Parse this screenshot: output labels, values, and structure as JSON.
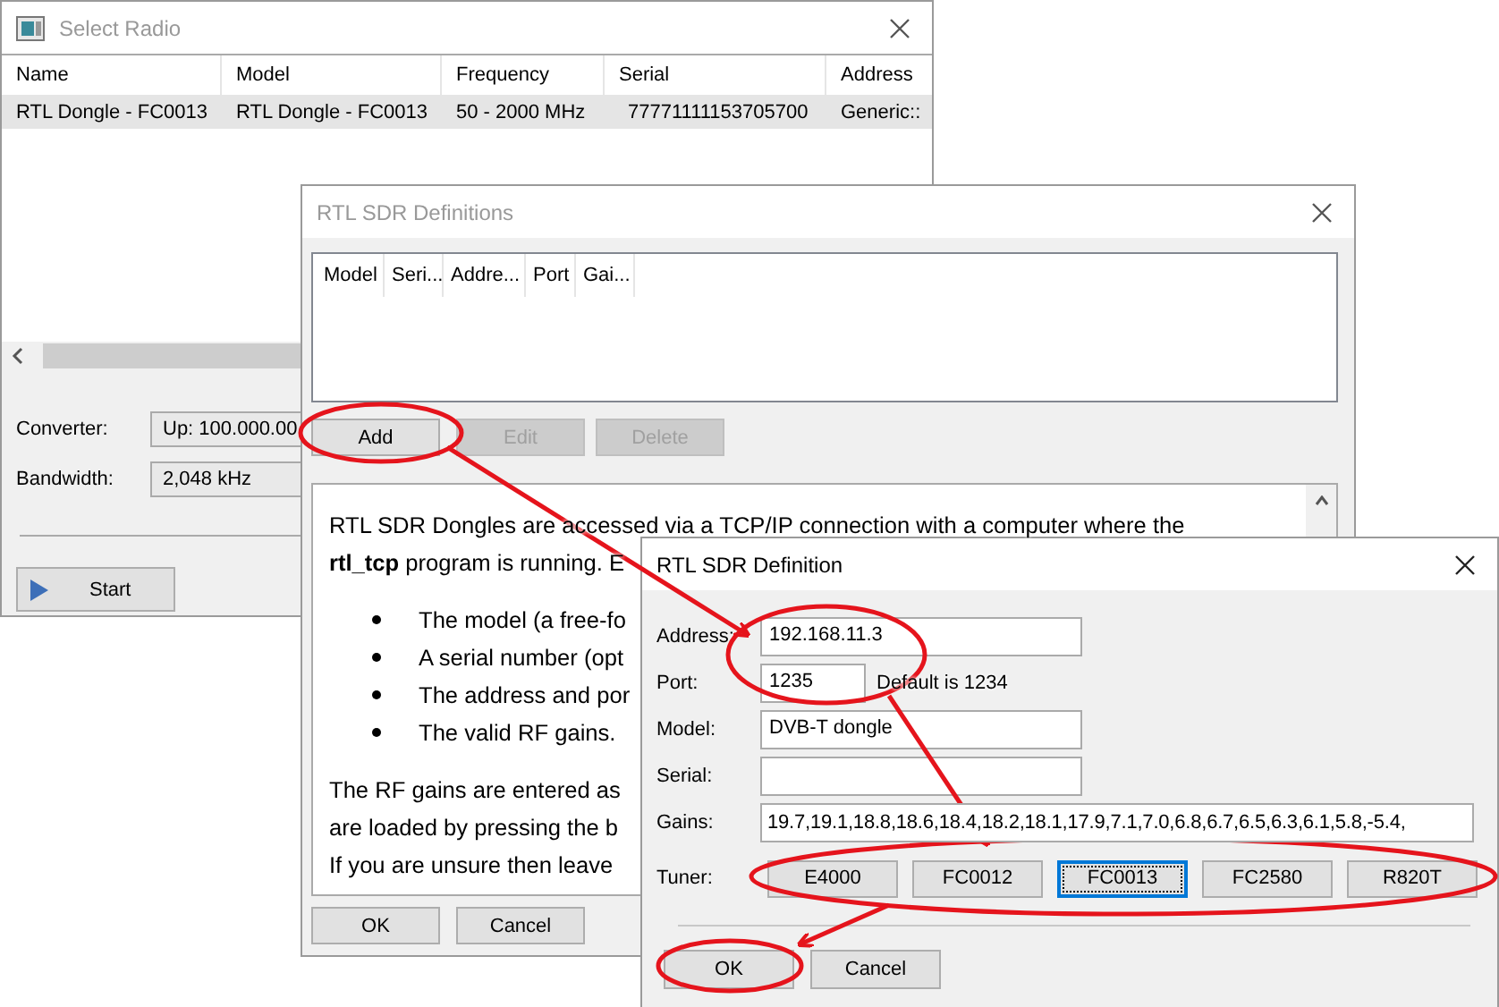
{
  "select_radio": {
    "title": "Select Radio",
    "active": false,
    "columns": [
      "Name",
      "Model",
      "Frequency",
      "Serial",
      "Address"
    ],
    "rows": [
      {
        "cells": [
          "RTL Dongle - FC0013",
          "RTL Dongle - FC0013",
          "50 - 2000 MHz",
          "77771111153705700",
          "Generic::"
        ],
        "selected": true
      }
    ],
    "converter": {
      "label": "Converter:",
      "value": "Up: 100.000.00"
    },
    "bandwidth": {
      "label": "Bandwidth:",
      "value": "2,048 kHz"
    },
    "start_button": "Start"
  },
  "definitions": {
    "title": "RTL SDR Definitions",
    "active": false,
    "columns": [
      "Model",
      "Seri...",
      "Addre...",
      "Port",
      "Gai..."
    ],
    "buttons": [
      {
        "label": "Add",
        "disabled": false
      },
      {
        "label": "Edit",
        "disabled": true
      },
      {
        "label": "Delete",
        "disabled": true
      }
    ],
    "help": {
      "intro": [
        "RTL SDR Dongles are accessed via a TCP/IP connection with a computer where the",
        "**rtl_tcp** program is running. E"
      ],
      "bullets": [
        "The model (a free-fo",
        "A serial number (opt",
        "The address and por",
        "The valid RF gains."
      ],
      "outro": [
        "The RF gains are entered as",
        "are loaded by pressing the b",
        "If you are unsure then leave"
      ]
    },
    "footer_buttons": [
      "OK",
      "Cancel"
    ]
  },
  "definition": {
    "title": "RTL SDR Definition",
    "active": true,
    "fields": [
      {
        "label": "Address:",
        "value": "192.168.11.3",
        "kind": "wide"
      },
      {
        "label": "Port:",
        "value": "1235",
        "kind": "short",
        "hint": "Default is 1234"
      },
      {
        "label": "Model:",
        "value": "DVB-T dongle",
        "kind": "wide"
      },
      {
        "label": "Serial:",
        "kind": "wide"
      },
      {
        "label": "Gains:",
        "value": "19.7,19.1,18.8,18.6,18.4,18.2,18.1,17.9,7.1,7.0,6.8,6.7,6.5,6.3,6.1,5.8,-5.4,",
        "kind": "full"
      }
    ],
    "tuner": {
      "label": "Tuner:",
      "options": [
        {
          "label": "E4000",
          "selected": false
        },
        {
          "label": "FC0012",
          "selected": false
        },
        {
          "label": "FC0013",
          "selected": true
        },
        {
          "label": "FC2580",
          "selected": false
        },
        {
          "label": "R820T",
          "selected": false
        }
      ]
    },
    "buttons": [
      "OK",
      "Cancel"
    ]
  }
}
